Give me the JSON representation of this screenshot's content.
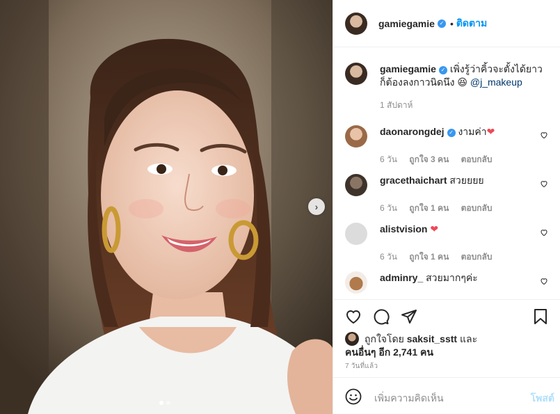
{
  "post": {
    "username": "gamiegamie",
    "follow_separator": "•",
    "follow_label": "ติดตาม",
    "caption_text": "เพิ่งรู้ว่าคิ้วจะตั้งได้ยาว ก็ต้องลงกาวนิดนึง 😆",
    "caption_mention": "@j_makeup",
    "caption_time": "1 สัปดาห์",
    "image_count": 2,
    "active_image": 1
  },
  "comments": [
    {
      "username": "daonarongdej",
      "verified": true,
      "text": "งามค่า",
      "emoji": "❤️",
      "time": "6 วัน",
      "likes": "ถูกใจ 3 คน",
      "reply": "ตอบกลับ"
    },
    {
      "username": "gracethaichart",
      "verified": false,
      "text": "สวยยยย",
      "emoji": "",
      "time": "6 วัน",
      "likes": "ถูกใจ 1 คน",
      "reply": "ตอบกลับ"
    },
    {
      "username": "alistvision",
      "verified": false,
      "text": "",
      "emoji": "❤️",
      "time": "6 วัน",
      "likes": "ถูกใจ 1 คน",
      "reply": "ตอบกลับ"
    },
    {
      "username": "adminry_",
      "verified": false,
      "text": "สวยมากๆค่ะ",
      "emoji": "",
      "time": "",
      "likes": "",
      "reply": ""
    }
  ],
  "likes": {
    "line1": "ถูกใจโดย",
    "liker": "saksit_sstt",
    "and": "และ",
    "line2": "คนอื่นๆ อีก 2,741 คน"
  },
  "posted_ago": "7 วันที่แล้ว",
  "add_comment": {
    "placeholder": "เพิ่มความคิดเห็น",
    "post_label": "โพสต์"
  },
  "icons": {
    "like": "heart-icon",
    "comment": "comment-icon",
    "share": "share-icon",
    "save": "bookmark-icon",
    "emoji": "smile-icon",
    "next": "chevron-right-icon"
  },
  "colors": {
    "link_blue": "#0095f6",
    "verified_blue": "#3897f0",
    "heart_red": "#ed4956",
    "muted_text": "#8e8e8e",
    "post_disabled": "#b2dffc"
  }
}
